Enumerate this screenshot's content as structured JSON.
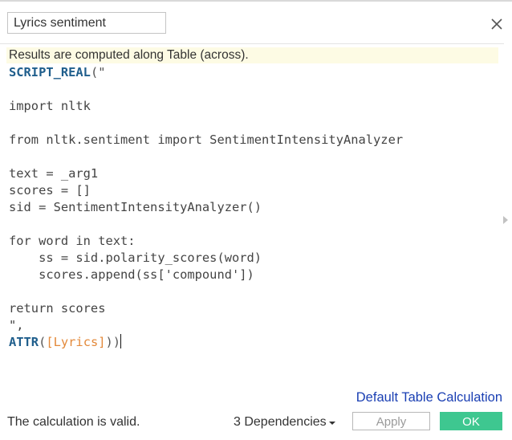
{
  "calc_name": "Lyrics sentiment",
  "notice": "Results are computed along Table (across).",
  "code": {
    "func": "SCRIPT_REAL",
    "open": "(\"",
    "lines": [
      "",
      "import nltk",
      "",
      "from nltk.sentiment import SentimentIntensityAnalyzer",
      "",
      "text = _arg1",
      "scores = []",
      "sid = SentimentIntensityAnalyzer()",
      "",
      "for word in text:",
      "    ss = sid.polarity_scores(word)",
      "    scores.append(ss['compound'])",
      "",
      "return scores",
      "\","
    ],
    "attr_func": "ATTR",
    "attr_open": "(",
    "field": "[Lyrics]",
    "close": "))"
  },
  "footer": {
    "default_link": "Default Table Calculation",
    "status": "The calculation is valid.",
    "dependencies": "3 Dependencies",
    "apply": "Apply",
    "ok": "OK"
  },
  "icons": {
    "close": "close-icon",
    "dependencies_caret": "chevron-down-icon",
    "side": "expand-right-icon"
  },
  "colors": {
    "ok_button": "#3ec790",
    "keyword": "#1f5e8c",
    "field": "#e3893a",
    "notice_bg": "#fdfbe4",
    "link": "#1a3fb3"
  }
}
